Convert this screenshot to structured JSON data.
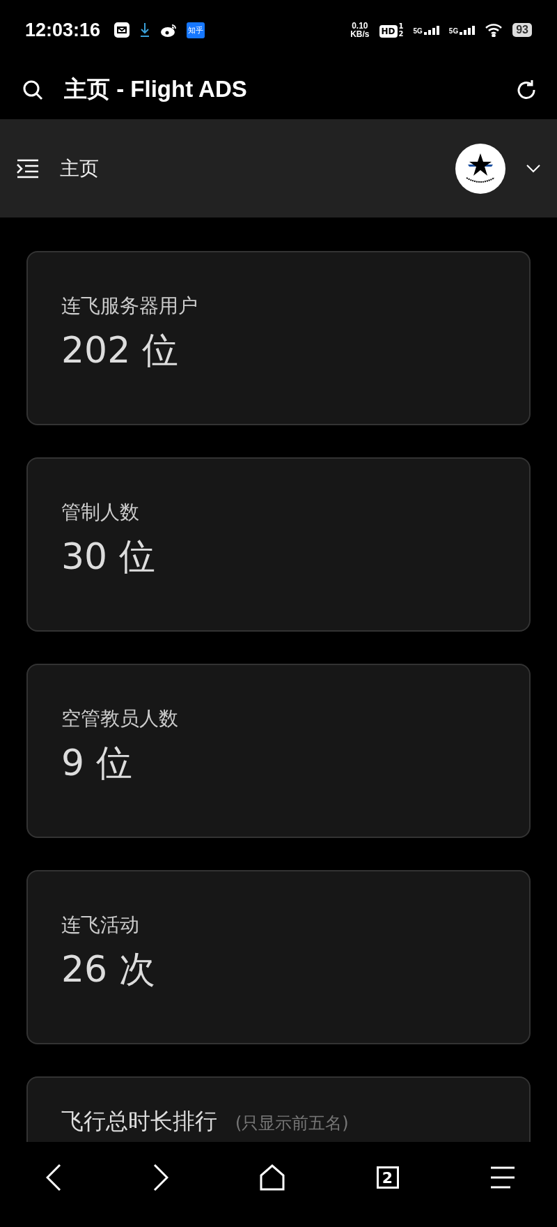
{
  "status_bar": {
    "time": "12:03:16",
    "notification_badge": "知乎",
    "speed": "0.10",
    "speed_unit": "KB/s",
    "hd": "HD",
    "sim_labels": [
      "1",
      "2"
    ],
    "networks": [
      "5G",
      "5G"
    ],
    "battery": "93"
  },
  "top_bar": {
    "title": "主页 - Flight ADS"
  },
  "header": {
    "title": "主页"
  },
  "cards": [
    {
      "label": "连飞服务器用户",
      "value": "202 位"
    },
    {
      "label": "管制人数",
      "value": "30 位"
    },
    {
      "label": "空管教员人数",
      "value": "9 位"
    },
    {
      "label": "连飞活动",
      "value": "26 次"
    }
  ],
  "ranking": {
    "title": "飞行总时长排行",
    "note": "(只显示前五名)"
  },
  "nav": {
    "tab_count": "2"
  }
}
